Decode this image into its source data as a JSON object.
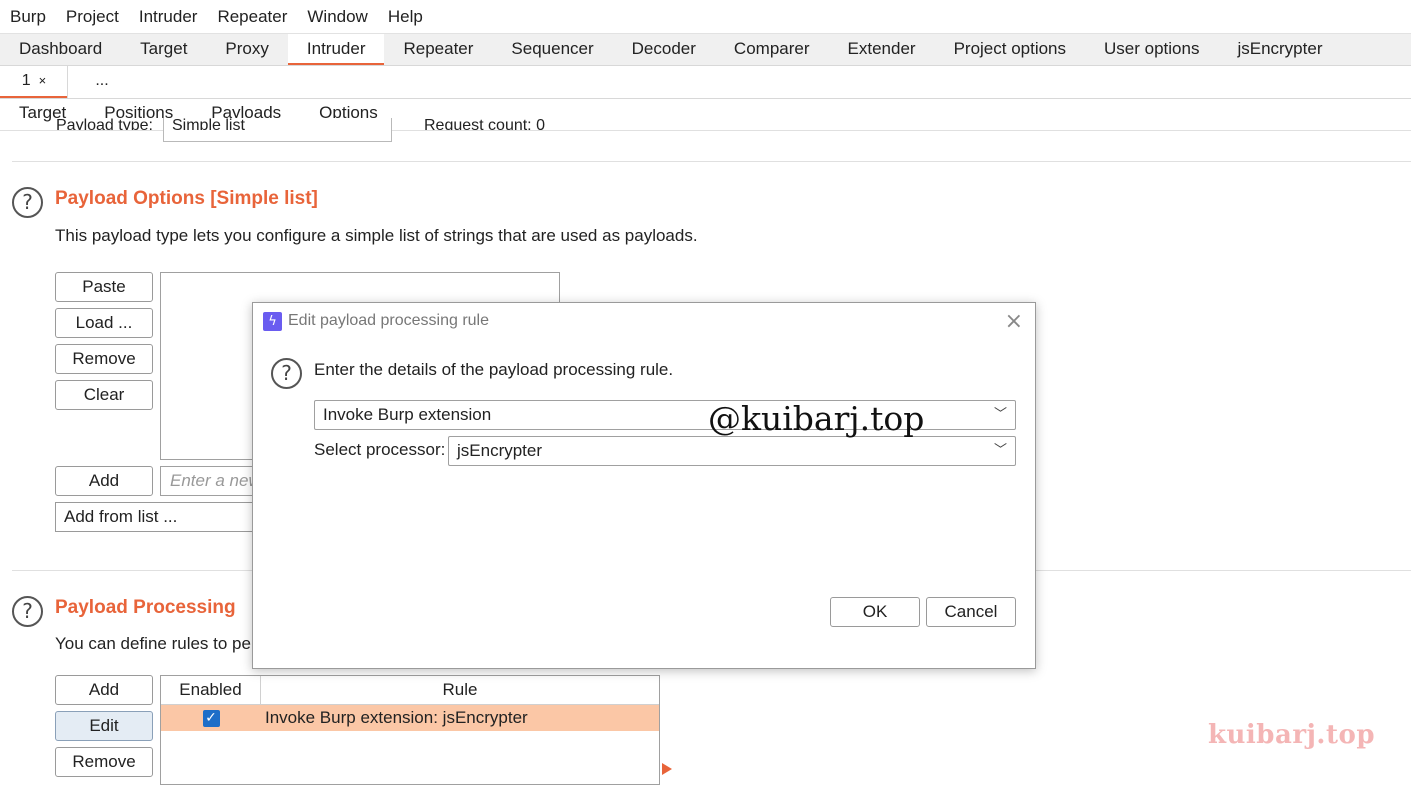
{
  "menu": [
    "Burp",
    "Project",
    "Intruder",
    "Repeater",
    "Window",
    "Help"
  ],
  "main_tabs": [
    "Dashboard",
    "Target",
    "Proxy",
    "Intruder",
    "Repeater",
    "Sequencer",
    "Decoder",
    "Comparer",
    "Extender",
    "Project options",
    "User options",
    "jsEncrypter"
  ],
  "active_main_tab": "Intruder",
  "attack_tabs": [
    {
      "label": "1",
      "close": "×"
    },
    {
      "label": "..."
    }
  ],
  "intruder_tabs": [
    "Target",
    "Positions",
    "Payloads",
    "Options"
  ],
  "active_intruder_tab": "Payloads",
  "cutoff": {
    "payload_type_label": "Payload type:",
    "payload_type_value": "Simple list",
    "request_count": "Request count: 0"
  },
  "payload_options": {
    "title": "Payload Options [Simple list]",
    "description": "This payload type lets you configure a simple list of strings that are used as payloads.",
    "buttons": [
      "Paste",
      "Load ...",
      "Remove",
      "Clear"
    ],
    "add_button": "Add",
    "add_placeholder": "Enter a new item",
    "add_from_list": "Add from list ..."
  },
  "payload_processing": {
    "title": "Payload Processing",
    "description": "You can define rules to pe",
    "buttons": [
      "Add",
      "Edit",
      "Remove"
    ],
    "columns": [
      "Enabled",
      "Rule"
    ],
    "rows": [
      {
        "enabled": true,
        "rule": "Invoke Burp extension: jsEncrypter"
      }
    ]
  },
  "dialog": {
    "title": "Edit payload processing rule",
    "message": "Enter the details of the payload processing rule.",
    "rule_type": "Invoke Burp extension",
    "processor_label": "Select processor:",
    "processor_value": "jsEncrypter",
    "ok": "OK",
    "cancel": "Cancel",
    "close_glyph": "×"
  },
  "watermarks": [
    "@kuibarj.top",
    "kuibarj.top"
  ],
  "colors": {
    "accent": "#e8643a",
    "selected_row": "#fbc7a6",
    "checkbox": "#1e6ec8",
    "logo": "#6a5cf0"
  }
}
